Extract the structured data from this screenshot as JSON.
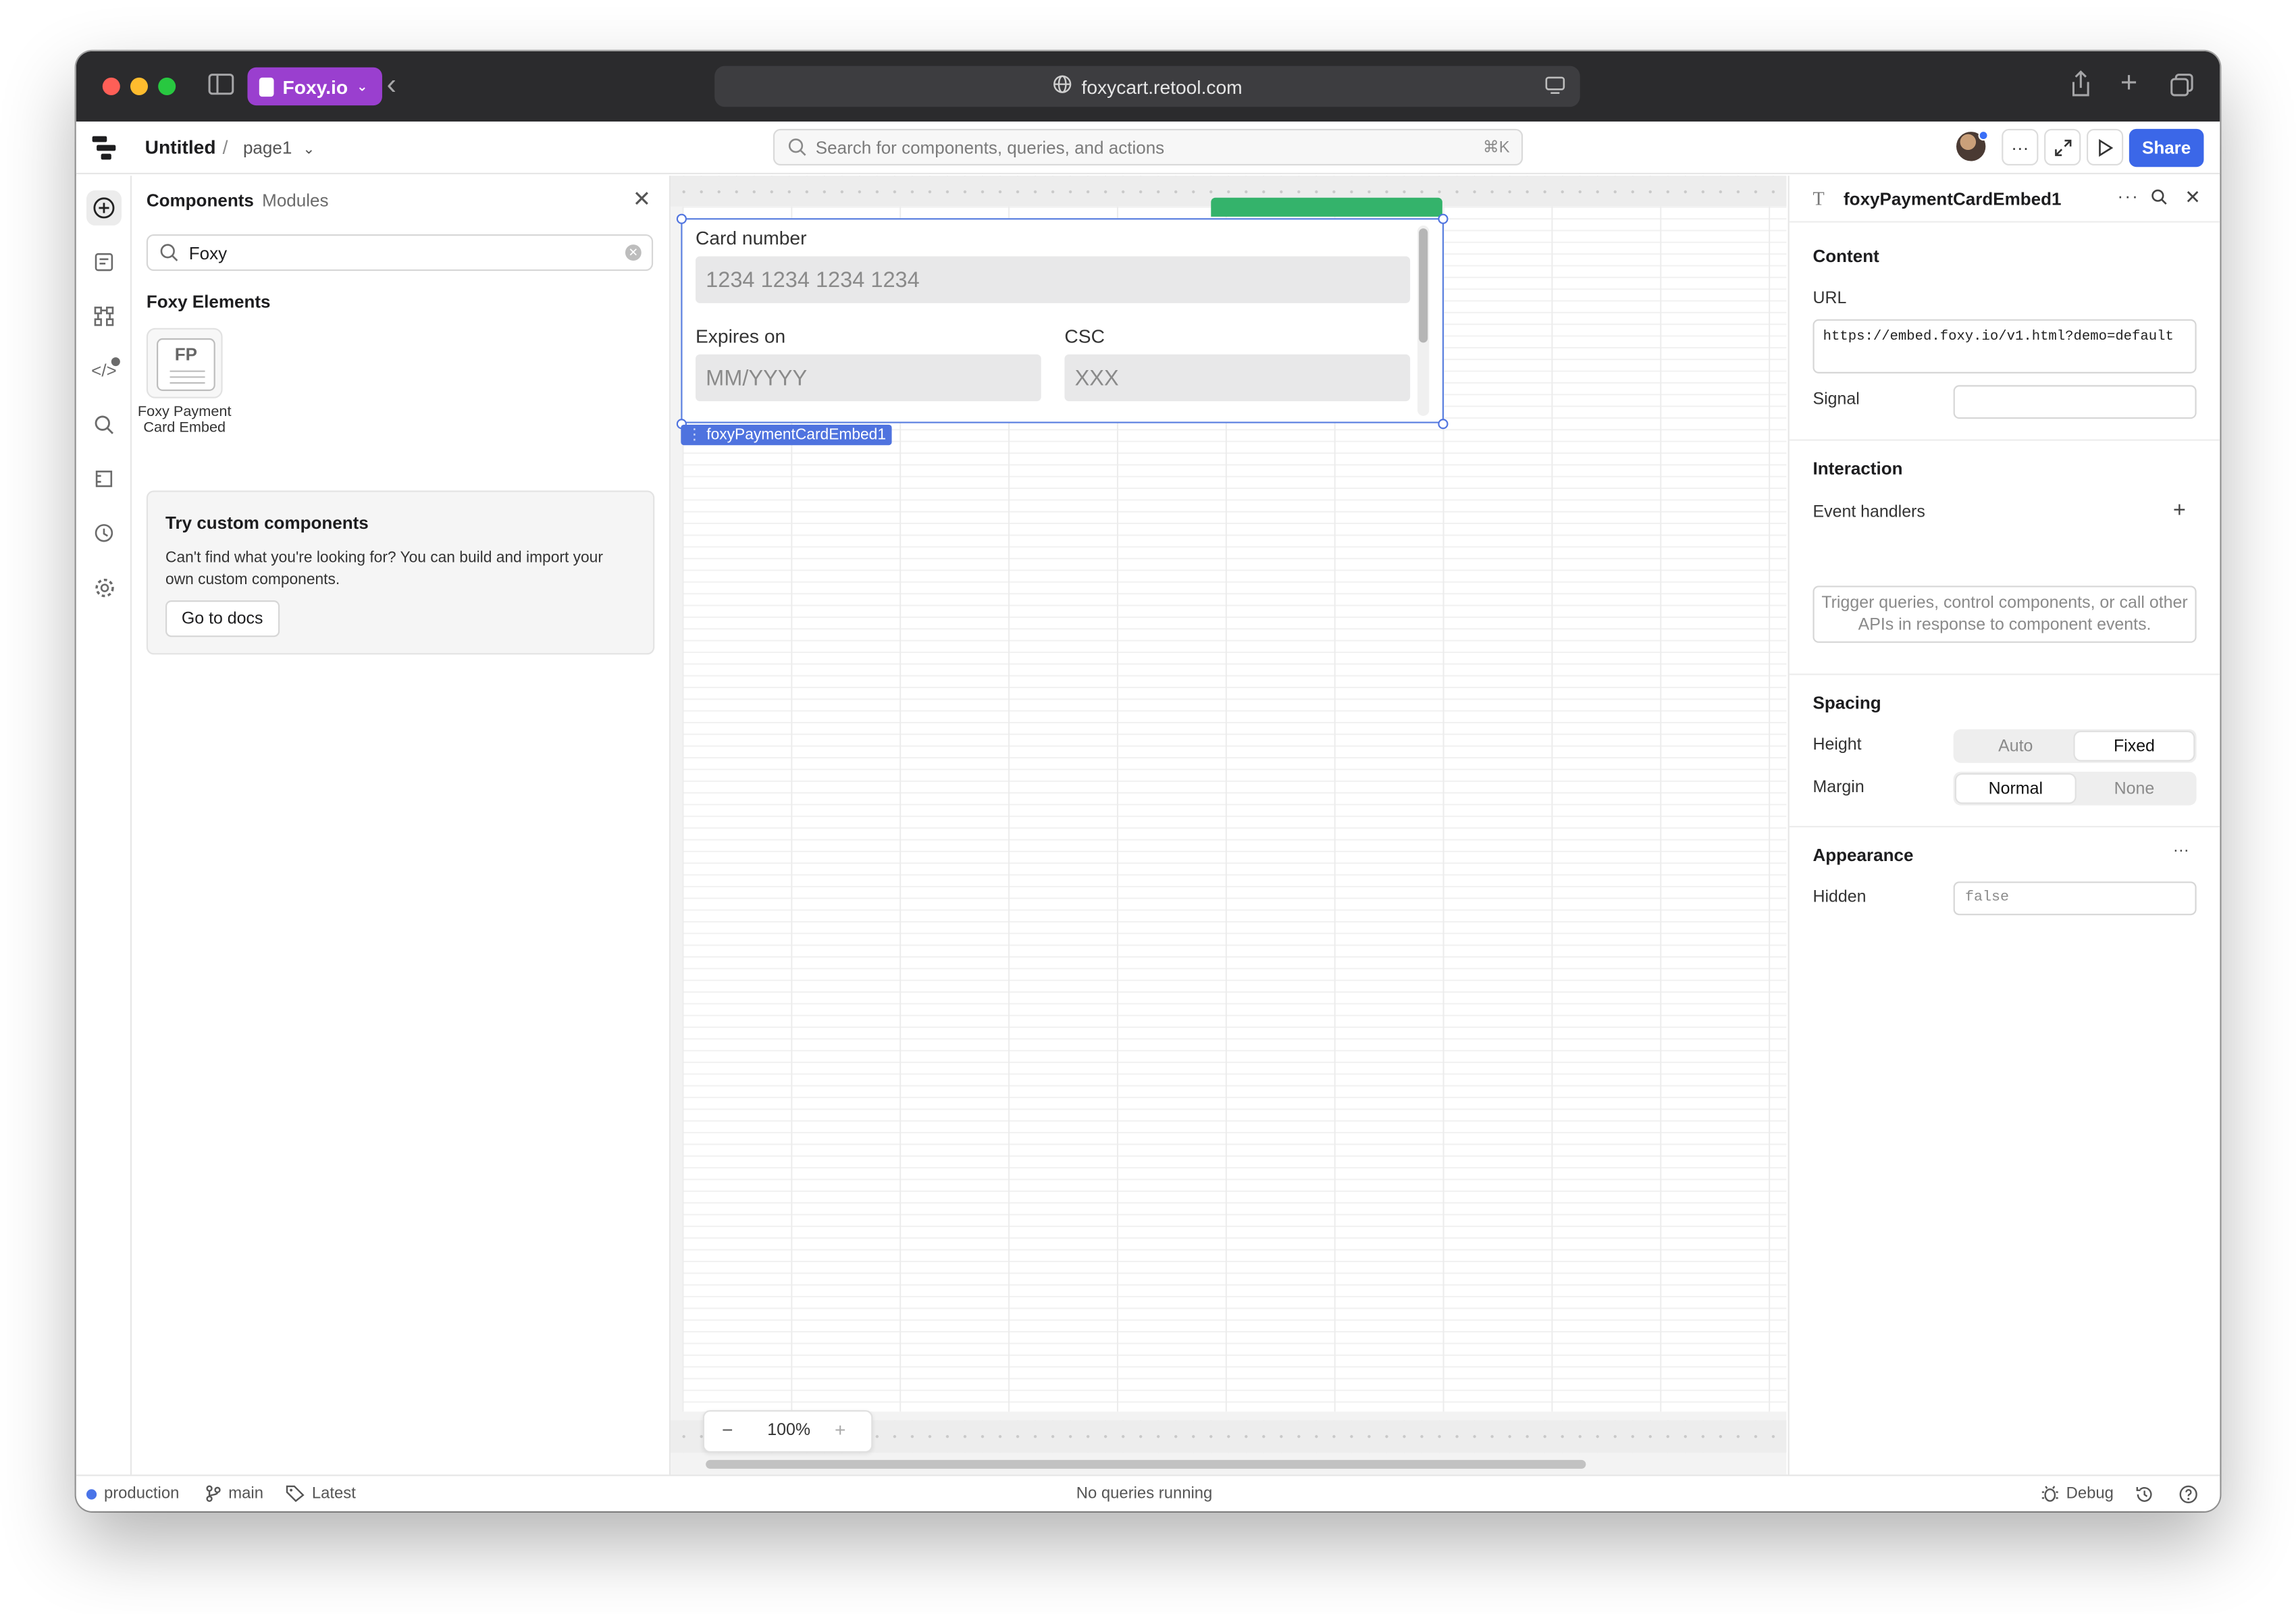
{
  "browser": {
    "workspace": "Foxy.io",
    "url": "foxycart.retool.com"
  },
  "appbar": {
    "app_title": "Untitled",
    "separator": "/",
    "page_name": "page1",
    "search_placeholder": "Search for components, queries, and actions",
    "search_shortcut": "⌘K",
    "more_label": "···",
    "share_label": "Share"
  },
  "panel": {
    "tab_components": "Components",
    "tab_modules": "Modules",
    "search_value": "Foxy",
    "section_title": "Foxy Elements",
    "tile_initials": "FP",
    "tile_label": "Foxy Payment Card Embed",
    "custom_title": "Try custom components",
    "custom_text": "Can't find what you're looking for? You can build and import your own custom components.",
    "custom_button": "Go to docs"
  },
  "canvas": {
    "card_number_label": "Card number",
    "card_number_placeholder": "1234 1234 1234 1234",
    "expires_label": "Expires on",
    "expires_placeholder": "MM/YYYY",
    "csc_label": "CSC",
    "csc_placeholder": "XXX",
    "component_tag": "foxyPaymentCardEmbed1",
    "zoom_level": "100%",
    "zoom_out": "−",
    "zoom_in": "+"
  },
  "inspector": {
    "title": "foxyPaymentCardEmbed1",
    "content_section": "Content",
    "url_label": "URL",
    "url_value": "https://embed.foxy.io/v1.html?demo=default",
    "signal_label": "Signal",
    "signal_value": "",
    "interaction_section": "Interaction",
    "event_handlers_label": "Event handlers",
    "event_handlers_empty": "Trigger queries, control components, or call other APIs in response to component events.",
    "spacing_section": "Spacing",
    "height_label": "Height",
    "height_options": [
      "Auto",
      "Fixed"
    ],
    "margin_label": "Margin",
    "margin_options": [
      "Normal",
      "None"
    ],
    "appearance_section": "Appearance",
    "hidden_label": "Hidden",
    "hidden_value": "false"
  },
  "status": {
    "environment": "production",
    "branch": "main",
    "release": "Latest",
    "queries": "No queries running",
    "debug": "Debug"
  },
  "colors": {
    "accent": "#3b67e8",
    "workspace": "#9a3fcf",
    "presence": "#34b36b"
  }
}
